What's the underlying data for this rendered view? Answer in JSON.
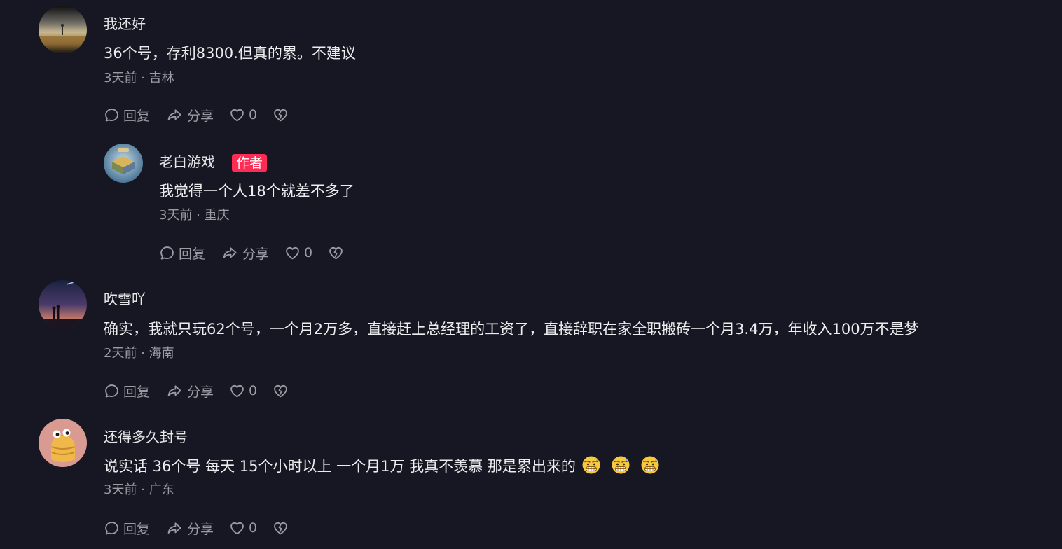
{
  "colors": {
    "background": "#161722",
    "author_badge": "#fe2c55",
    "meta_text": "#9a9ba3"
  },
  "comments": [
    {
      "username": "我还好",
      "text": "36个号，存利8300.但真的累。不建议",
      "meta": "3天前 · 吉林",
      "reply_label": "回复",
      "share_label": "分享",
      "like_count": "0"
    },
    {
      "username": "老白游戏",
      "badge": "作者",
      "text": "我觉得一个人18个就差不多了",
      "meta": "3天前 · 重庆",
      "reply_label": "回复",
      "share_label": "分享",
      "like_count": "0"
    },
    {
      "username": "吹雪吖",
      "text": "确实，我就只玩62个号，一个月2万多，直接赶上总经理的工资了，直接辞职在家全职搬砖一个月3.4万，年收入100万不是梦",
      "meta": "2天前 · 海南",
      "reply_label": "回复",
      "share_label": "分享",
      "like_count": "0"
    },
    {
      "username": "还得多久封号",
      "text": "说实话 36个号 每天 15个小时以上  一个月1万 我真不羡慕  那是累出来的",
      "emojis": [
        "grimacing-sweat-emoji",
        "grimacing-sweat-emoji",
        "grimacing-sweat-emoji"
      ],
      "meta": "3天前 · 广东",
      "reply_label": "回复",
      "share_label": "分享",
      "like_count": "0"
    }
  ]
}
